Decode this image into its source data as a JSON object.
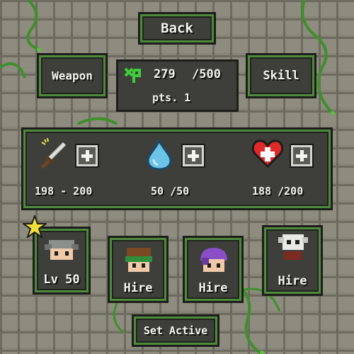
{
  "top": {
    "back_label": "Back"
  },
  "nav": {
    "weapon_label": "Weapon",
    "skill_label": "Skill"
  },
  "xp": {
    "current": "279",
    "max": "/500",
    "points_label": "pts. 1"
  },
  "stats": {
    "attack": {
      "icon": "sword-icon",
      "value": "198 - 200"
    },
    "mana": {
      "icon": "water-drop-icon",
      "value": "50 /50"
    },
    "health": {
      "icon": "heart-icon",
      "value": "188 /200"
    }
  },
  "heroes": [
    {
      "icon": "grey-hair-hero-icon",
      "label": "Lv 50",
      "starred": true
    },
    {
      "icon": "bandana-hero-icon",
      "label": "Hire"
    },
    {
      "icon": "purple-hood-hero-icon",
      "label": "Hire"
    },
    {
      "icon": "skull-helmet-hero-icon",
      "label": "Hire"
    }
  ],
  "bottom": {
    "set_active_label": "Set Active"
  },
  "colors": {
    "panel": "#3e3f3b",
    "frame_green": "#4f8a3c",
    "text": "#f4f4f0",
    "brick": "#8d8c7e",
    "mortar": "#6e6c60"
  }
}
